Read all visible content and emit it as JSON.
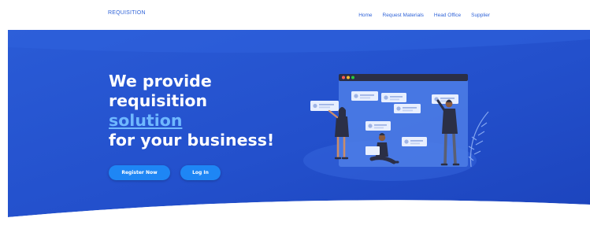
{
  "header": {
    "brand": "REQUISITION",
    "nav": [
      "Home",
      "Request Materials",
      "Head Office",
      "Supplier"
    ]
  },
  "hero": {
    "headline": {
      "line1": "We provide",
      "line2": "requisition",
      "line3": "solution",
      "line4": "for your business!"
    },
    "buttons": {
      "register": "Register Now",
      "login": "Log In"
    }
  },
  "colors": {
    "hero_blue": "#2352cf",
    "accent_text": "#6fb8ff",
    "button_blue": "#1e86f5",
    "nav_text": "#2f63d8"
  },
  "icons": {
    "illustration": "team-collaboration-illustration"
  }
}
